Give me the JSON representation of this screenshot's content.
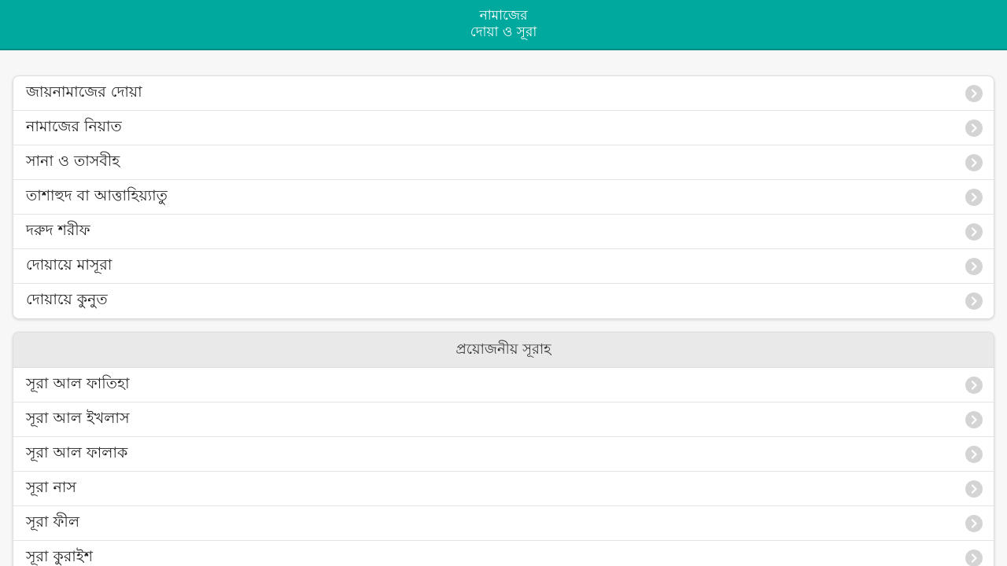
{
  "header": {
    "title_line1": "নামাজের",
    "title_line2": "দোয়া ও সূরা"
  },
  "duas": {
    "items": [
      {
        "label": "জায়নামাজের দোয়া"
      },
      {
        "label": "নামাজের নিয়াত"
      },
      {
        "label": "সানা ও তাসবীহ"
      },
      {
        "label": "তাশাহুদ বা আত্তাহিয়্যাতু"
      },
      {
        "label": "দরুদ শরীফ"
      },
      {
        "label": "দোয়ায়ে মাসূরা"
      },
      {
        "label": "দোয়ায়ে কুনুত"
      }
    ]
  },
  "surahs": {
    "title": "প্রয়োজনীয় সূরাহ",
    "items": [
      {
        "label": "সূরা আল ফাতিহা"
      },
      {
        "label": "সূরা আল ইখলাস"
      },
      {
        "label": "সূরা আল ফালাক"
      },
      {
        "label": "সূরা নাস"
      },
      {
        "label": "সূরা ফীল"
      },
      {
        "label": "সূরা কুরাইশ"
      }
    ]
  },
  "icons": {
    "row_arrow": "chevron-right-circle-icon"
  },
  "colors": {
    "header_bg": "#00a99d",
    "section_bg": "#e9e9e9",
    "chevron_bg": "#d4d4d4"
  }
}
